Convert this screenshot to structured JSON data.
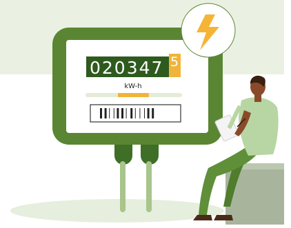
{
  "meter": {
    "reading_main": "020347",
    "reading_last_digit": "5",
    "unit": "kW-h",
    "usage_fraction": 0.32
  },
  "icons": {
    "badge": "lightning-bolt-icon",
    "barcode": "barcode-icon"
  },
  "colors": {
    "background_band": "#eaf1e2",
    "meter_body": "#5a8633",
    "meter_border": "#3f6e27",
    "display_bg": "#2f5a1e",
    "last_digit_bg": "#f0b43a",
    "bolt": "#f5b436",
    "progress_fill": "#f0b43a",
    "progress_track": "#e3ecd9",
    "ground_shadow": "#e6eedd",
    "person_skin": "#8a4a2a",
    "person_shirt": "#b7d6a3",
    "person_pants": "#5f8f38",
    "seat": "#a8b59c"
  }
}
